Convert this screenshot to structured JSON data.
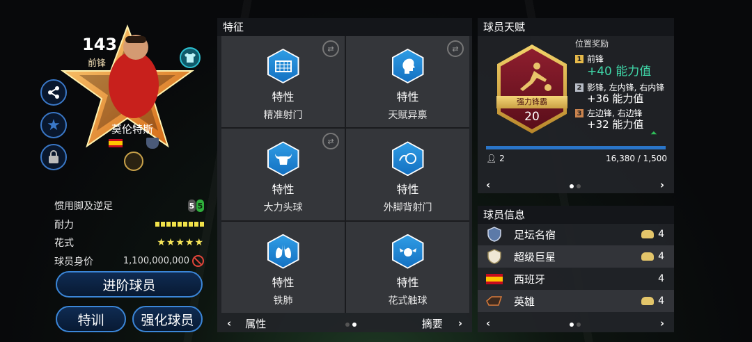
{
  "card": {
    "rating": "143",
    "position": "前锋",
    "name": "莫伦特斯"
  },
  "stats": {
    "weak_foot_label": "惯用脚及逆足",
    "weak_foot_left": "5",
    "weak_foot_right": "5",
    "stamina_label": "耐力",
    "stamina_level": 1.0,
    "skill_label": "花式",
    "skill_stars": "★★★★★",
    "value_label": "球员身价",
    "value": "1,100,000,000"
  },
  "buttons": {
    "advance": "进阶球员",
    "train": "特训",
    "upgrade": "强化球员"
  },
  "traits": {
    "title": "特征",
    "items": [
      {
        "type": "特性",
        "name": "精准射门",
        "icon": "goal-net-icon"
      },
      {
        "type": "特性",
        "name": "天赋异禀",
        "icon": "head-profile-icon"
      },
      {
        "type": "特性",
        "name": "大力头球",
        "icon": "bull-icon"
      },
      {
        "type": "特性",
        "name": "外脚背射门",
        "icon": "ball-curve-icon"
      },
      {
        "type": "特性",
        "name": "铁肺",
        "icon": "lungs-icon"
      },
      {
        "type": "特性",
        "name": "花式触球",
        "icon": "winged-ball-icon"
      }
    ],
    "nav_prev": "属性",
    "nav_next": "摘要"
  },
  "talent": {
    "title": "球员天赋",
    "badge_name": "强力锋霸",
    "badge_level": "20",
    "reward_title": "位置奖励",
    "rewards": [
      {
        "rank": "1",
        "positions": "前锋",
        "bonus": "+40 能力值"
      },
      {
        "rank": "2",
        "positions": "影锋, 左内锋, 右内锋",
        "bonus": "+36 能力值"
      },
      {
        "rank": "3",
        "positions": "左边锋, 右边锋",
        "bonus": "+32 能力值"
      }
    ],
    "fans": "2",
    "progress_text": "16,380 / 1,500"
  },
  "info": {
    "title": "球员信息",
    "rows": [
      {
        "label": "足坛名宿",
        "level": "4"
      },
      {
        "label": "超级巨星",
        "level": "4"
      },
      {
        "label": "西班牙",
        "level": "4"
      },
      {
        "label": "英雄",
        "level": "4"
      }
    ]
  },
  "colors": {
    "accent_blue": "#3b86d8",
    "bonus_green": "#3fd6a8",
    "talent_red": "#8e1e2e",
    "gold": "#e6b94a"
  }
}
